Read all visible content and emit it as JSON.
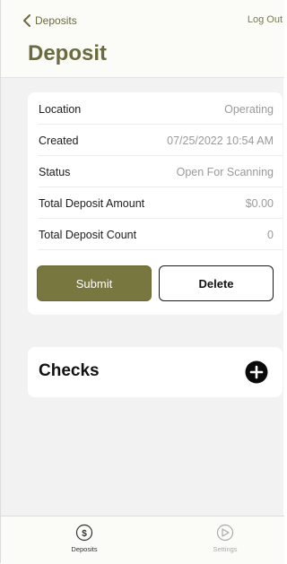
{
  "nav": {
    "back_label": "Deposits",
    "logout_label": "Log Out",
    "title": "Deposit"
  },
  "details": [
    {
      "label": "Location",
      "value": "Operating"
    },
    {
      "label": "Created",
      "value": "07/25/2022 10:54 AM"
    },
    {
      "label": "Status",
      "value": "Open For Scanning"
    },
    {
      "label": "Total Deposit Amount",
      "value": "$0.00"
    },
    {
      "label": "Total Deposit Count",
      "value": "0"
    }
  ],
  "actions": {
    "submit_label": "Submit",
    "delete_label": "Delete"
  },
  "checks": {
    "title": "Checks"
  },
  "tabs": [
    {
      "label": "Deposits",
      "icon": "dollar-circle-icon",
      "active": true
    },
    {
      "label": "Settings",
      "icon": "settings-icon",
      "active": false
    }
  ],
  "colors": {
    "accent": "#6b6b40",
    "submit_bg": "#77773f"
  }
}
